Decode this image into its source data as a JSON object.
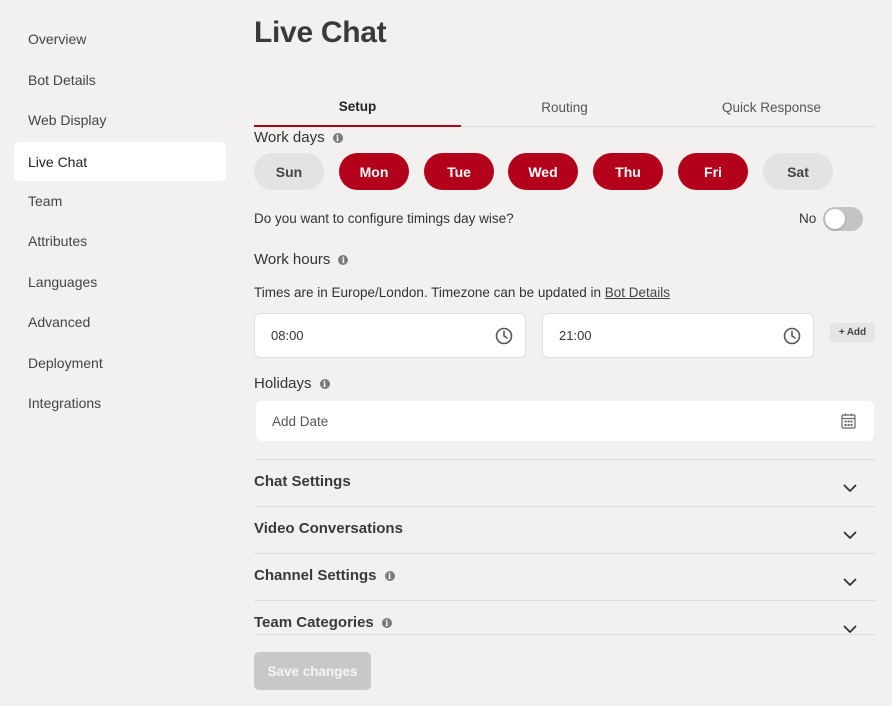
{
  "sidebar": {
    "items": [
      {
        "label": "Overview"
      },
      {
        "label": "Bot Details"
      },
      {
        "label": "Web Display"
      },
      {
        "label": "Live Chat",
        "active": true
      },
      {
        "label": "Team"
      },
      {
        "label": "Attributes"
      },
      {
        "label": "Languages"
      },
      {
        "label": "Advanced"
      },
      {
        "label": "Deployment"
      },
      {
        "label": "Integrations"
      }
    ]
  },
  "page": {
    "title": "Live Chat"
  },
  "tabs": [
    {
      "label": "Setup",
      "active": true
    },
    {
      "label": "Routing"
    },
    {
      "label": "Quick Response"
    }
  ],
  "work_days": {
    "label": "Work days",
    "info_icon": "info-icon",
    "days": [
      {
        "label": "Sun",
        "selected": false
      },
      {
        "label": "Mon",
        "selected": true
      },
      {
        "label": "Tue",
        "selected": true
      },
      {
        "label": "Wed",
        "selected": true
      },
      {
        "label": "Thu",
        "selected": true
      },
      {
        "label": "Fri",
        "selected": true
      },
      {
        "label": "Sat",
        "selected": false
      }
    ]
  },
  "daywise": {
    "question": "Do you want to configure timings day wise?",
    "toggle_label": "No",
    "enabled": false
  },
  "work_hours": {
    "label": "Work hours",
    "timezone_text": "Times are in Europe/London. Timezone can be updated in ",
    "timezone_link": "Bot Details",
    "start": "08:00",
    "end": "21:00",
    "add_label": "Add",
    "add_icon": "plus-icon",
    "clock_icon": "clock-icon"
  },
  "holidays": {
    "label": "Holidays",
    "placeholder": "Add Date",
    "calendar_icon": "calendar-icon"
  },
  "accordions": [
    {
      "title": "Chat Settings",
      "info": false
    },
    {
      "title": "Video Conversations",
      "info": false
    },
    {
      "title": "Channel Settings",
      "info": true
    },
    {
      "title": "Team Categories",
      "info": true
    }
  ],
  "save_button": {
    "label": "Save changes",
    "disabled": true
  },
  "colors": {
    "accent": "#b3001b",
    "background": "#f2f1f0",
    "day_off": "#e4e3e2",
    "disabled_button": "#c8c8c8"
  }
}
